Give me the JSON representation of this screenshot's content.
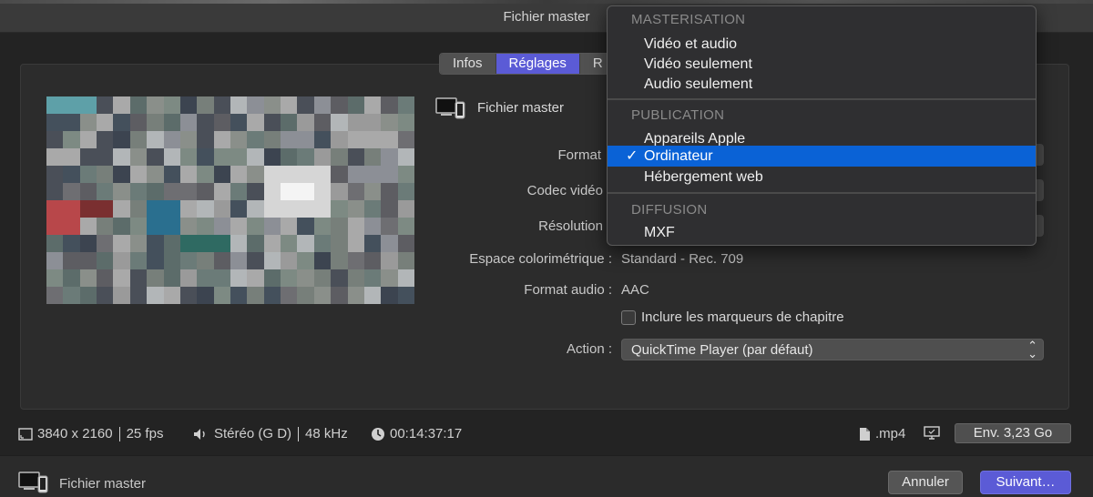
{
  "window": {
    "title": "Fichier master"
  },
  "tabs": [
    {
      "label": "Infos",
      "active": false
    },
    {
      "label": "Réglages",
      "active": true
    },
    {
      "label": "R",
      "active": false
    }
  ],
  "file": {
    "name": "Fichier master",
    "icon": "computer-device-icon"
  },
  "settings": {
    "format_label": "Format",
    "codec_label": "Codec vidéo",
    "resolution_label": "Résolution",
    "colorspace_label": "Espace colorimétrique :",
    "colorspace_value": "Standard - Rec. 709",
    "audio_label": "Format audio :",
    "audio_value": "AAC",
    "chapters_label": "Inclure les marqueurs de chapitre",
    "chapters_checked": false,
    "action_label": "Action :",
    "action_value": "QuickTime Player (par défaut)"
  },
  "info": {
    "resolution": "3840 x 2160",
    "fps": "25 fps",
    "audio": "Stéréo (G D)",
    "sample_rate": "48 kHz",
    "duration": "00:14:37:17",
    "extension": ".mp4",
    "size": "Env. 3,23 Go"
  },
  "footer": {
    "label": "Fichier master",
    "cancel": "Annuler",
    "next": "Suivant…"
  },
  "menu": {
    "sections": [
      {
        "header": "MASTERISATION",
        "items": [
          "Vidéo et audio",
          "Vidéo seulement",
          "Audio seulement"
        ]
      },
      {
        "header": "PUBLICATION",
        "items": [
          "Appareils Apple",
          "Ordinateur",
          "Hébergement web"
        ]
      },
      {
        "header": "DIFFUSION",
        "items": [
          "MXF"
        ]
      }
    ],
    "selected": "Ordinateur"
  },
  "colors": {
    "accent": "#5b5bd6",
    "menu_highlight": "#0a62d6"
  }
}
